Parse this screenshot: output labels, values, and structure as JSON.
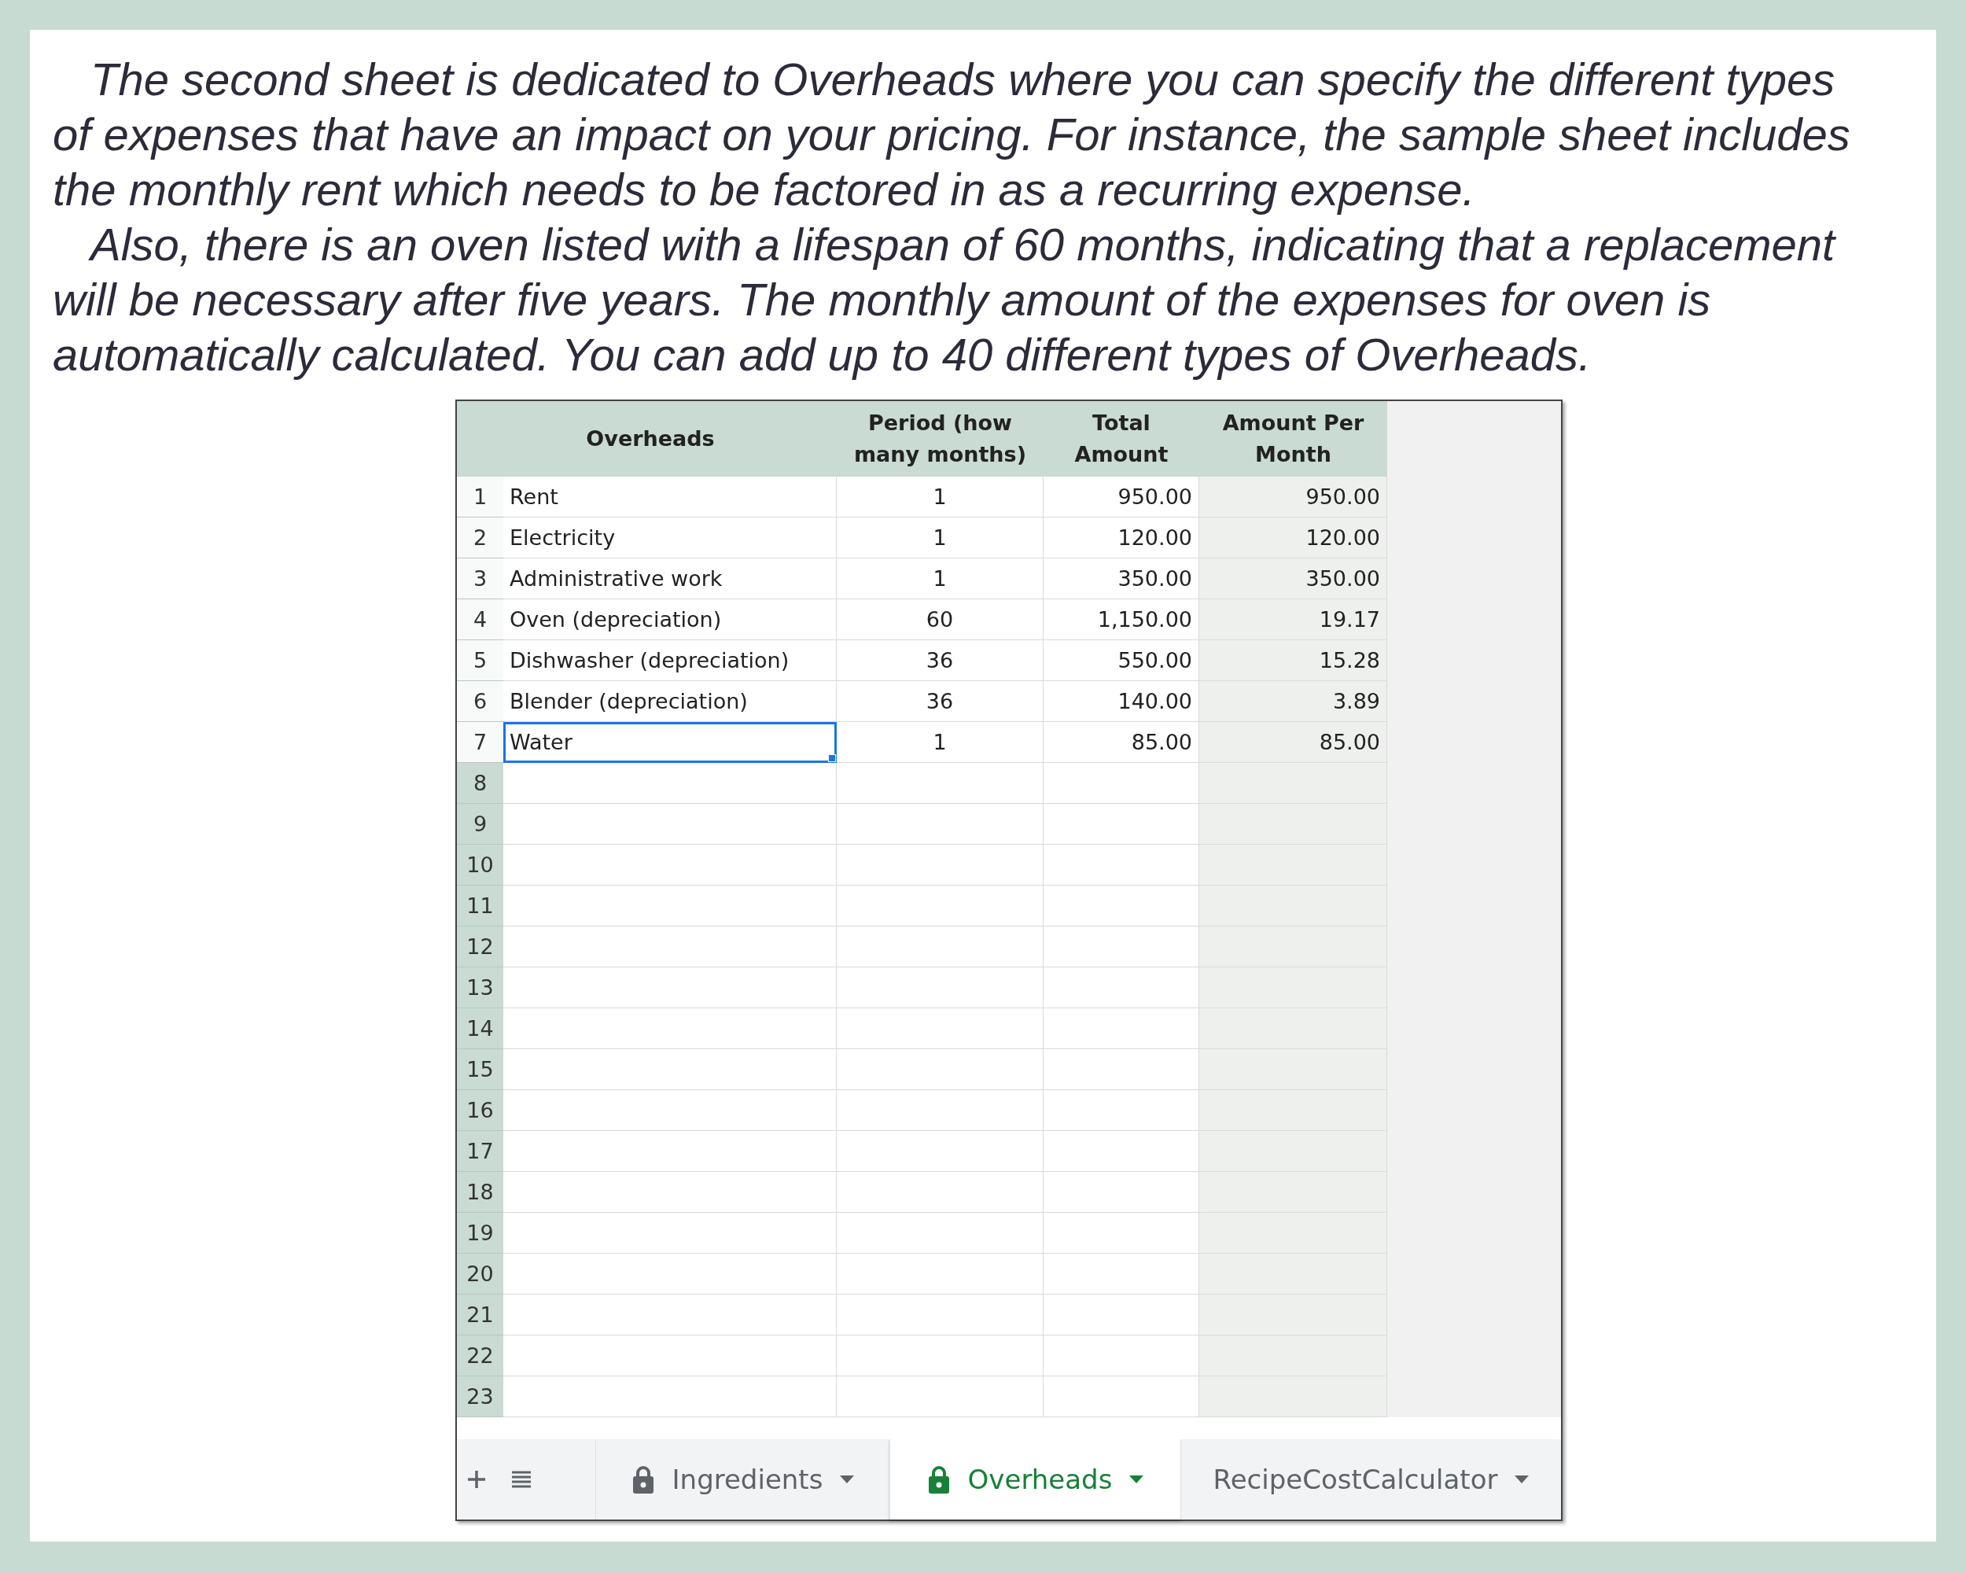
{
  "paragraphs": [
    {
      "lines": [
        "The second sheet is dedicated to Overheads where you can specify the different types",
        "of expenses that have an impact on your pricing. For instance, the sample sheet includes",
        "the monthly rent which needs to be factored in as a recurring expense."
      ]
    },
    {
      "lines": [
        "Also, there is an oven listed with a lifespan of 60 months, indicating that a replacement",
        "will be necessary after five years. The monthly amount of the expenses for oven is",
        "automatically calculated. You can add up to 40 different types of Overheads."
      ]
    }
  ],
  "sheet": {
    "columns": [
      "Overheads",
      "Period (how many months)",
      "Total Amount",
      "Amount Per Month"
    ],
    "rows": [
      {
        "number": "1",
        "name": "Rent",
        "period": "1",
        "total": "950.00",
        "per_month": "950.00",
        "selected": false
      },
      {
        "number": "2",
        "name": "Electricity",
        "period": "1",
        "total": "120.00",
        "per_month": "120.00",
        "selected": false
      },
      {
        "number": "3",
        "name": "Administrative work",
        "period": "1",
        "total": "350.00",
        "per_month": "350.00",
        "selected": false
      },
      {
        "number": "4",
        "name": "Oven (depreciation)",
        "period": "60",
        "total": "1,150.00",
        "per_month": "19.17",
        "selected": false
      },
      {
        "number": "5",
        "name": "Dishwasher (depreciation)",
        "period": "36",
        "total": "550.00",
        "per_month": "15.28",
        "selected": false
      },
      {
        "number": "6",
        "name": "Blender (depreciation)",
        "period": "36",
        "total": "140.00",
        "per_month": "3.89",
        "selected": false
      },
      {
        "number": "7",
        "name": "Water",
        "period": "1",
        "total": "85.00",
        "per_month": "85.00",
        "selected": true
      }
    ],
    "empty_row_numbers": [
      "8",
      "9",
      "10",
      "11",
      "12",
      "13",
      "14",
      "15",
      "16",
      "17",
      "18",
      "19",
      "20",
      "21",
      "22",
      "23"
    ],
    "tabs": [
      {
        "label": "Ingredients",
        "locked": true,
        "selected": false
      },
      {
        "label": "Overheads",
        "locked": true,
        "selected": true
      },
      {
        "label": "RecipeCostCalculator",
        "locked": false,
        "selected": false
      }
    ]
  }
}
